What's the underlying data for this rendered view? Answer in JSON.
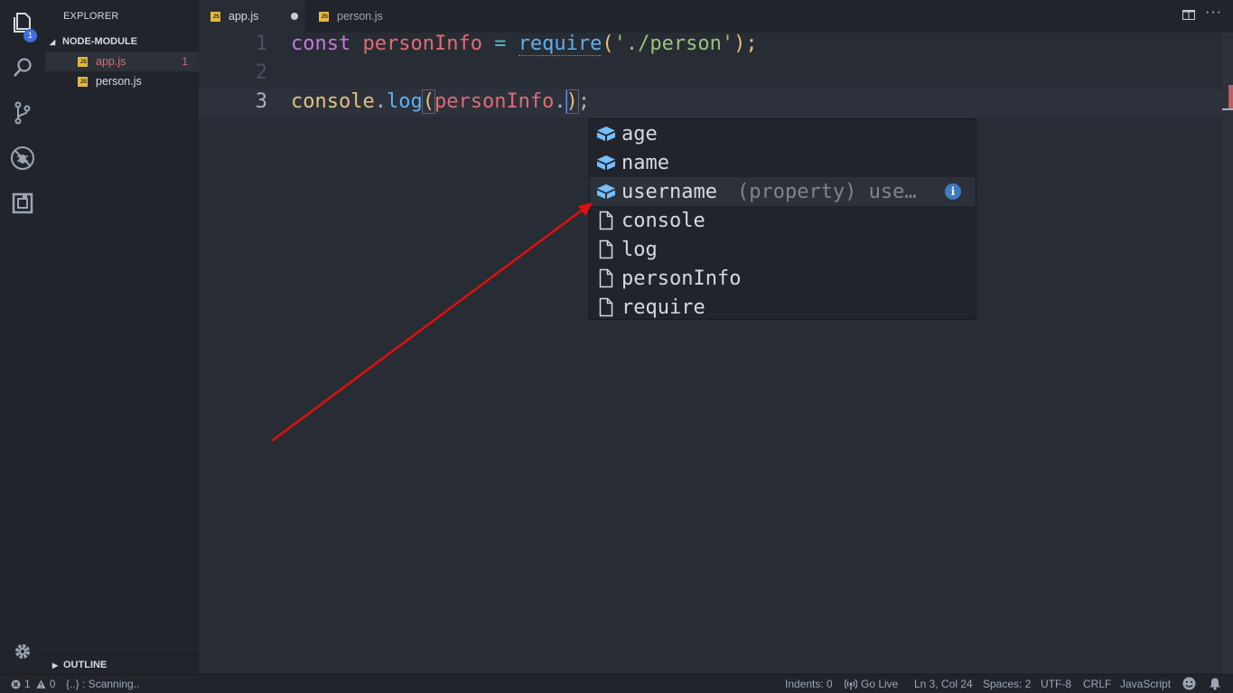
{
  "activity_bar": {
    "items": [
      {
        "name": "explorer",
        "icon": "files-icon",
        "badge": "1"
      },
      {
        "name": "search",
        "icon": "search-icon"
      },
      {
        "name": "source-control",
        "icon": "source-control-icon"
      },
      {
        "name": "debug",
        "icon": "debug-icon"
      },
      {
        "name": "extensions",
        "icon": "extensions-icon"
      }
    ],
    "settings_icon": "gear-icon"
  },
  "sidebar": {
    "title": "EXPLORER",
    "folder": "NODE-MODULE",
    "files": [
      {
        "name": "app.js",
        "errors": "1",
        "active": true,
        "icon_text": "JS"
      },
      {
        "name": "person.js",
        "errors": "",
        "active": false,
        "icon_text": "JS"
      }
    ],
    "outline_label": "OUTLINE"
  },
  "tabs": [
    {
      "label": "app.js",
      "icon_text": "JS",
      "dirty": true,
      "active": true
    },
    {
      "label": "person.js",
      "icon_text": "JS",
      "dirty": false,
      "active": false
    }
  ],
  "editor": {
    "line_numbers": [
      "1",
      "2",
      "3"
    ],
    "line1": {
      "kw": "const",
      "var": "personInfo",
      "eq": "=",
      "fn": "require",
      "open": "(",
      "str": "'./person'",
      "close": ");"
    },
    "line3": {
      "obj": "console",
      "dot1": ".",
      "fn": "log",
      "open": "(",
      "var": "personInfo",
      "dot2": ".",
      "close": ")",
      "semi": ";"
    }
  },
  "suggestions": [
    {
      "label": "age",
      "kind": "property",
      "detail": "",
      "focused": false
    },
    {
      "label": "name",
      "kind": "property",
      "detail": "",
      "focused": false
    },
    {
      "label": "username",
      "kind": "property",
      "detail": "(property) use…",
      "focused": true
    },
    {
      "label": "console",
      "kind": "text",
      "detail": "",
      "focused": false
    },
    {
      "label": "log",
      "kind": "text",
      "detail": "",
      "focused": false
    },
    {
      "label": "personInfo",
      "kind": "text",
      "detail": "",
      "focused": false
    },
    {
      "label": "require",
      "kind": "text",
      "detail": "",
      "focused": false
    }
  ],
  "status_bar": {
    "errors": "1",
    "warnings": "0",
    "scanning": "{..} : Scanning..",
    "indents": "Indents: 0",
    "go_live": "Go Live",
    "cursor": "Ln 3, Col 24",
    "spaces": "Spaces: 2",
    "encoding": "UTF-8",
    "eol": "CRLF",
    "language": "JavaScript"
  },
  "colors": {
    "background": "#282c34",
    "sidebar": "#21252b",
    "keyword": "#c678dd",
    "variable": "#e06c75",
    "function": "#61afef",
    "string": "#98c379",
    "annotation_arrow": "#e01010"
  }
}
